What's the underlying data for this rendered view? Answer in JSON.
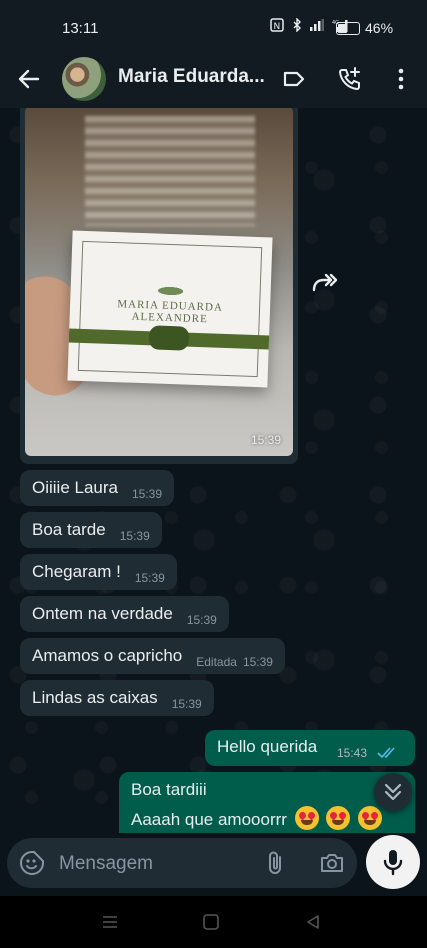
{
  "status_bar": {
    "time": "13:11",
    "battery": "46%",
    "battery_level": 0.46,
    "network": "4G"
  },
  "header": {
    "contact_name": "Maria Eduarda...",
    "icons": [
      "back-arrow-icon",
      "label-tag-icon",
      "add-call-icon",
      "more-vert-icon"
    ]
  },
  "chat": {
    "image_message": {
      "box_text": [
        "MARIA EDUARDA",
        "ALEXANDRE"
      ],
      "time": "15:39"
    },
    "incoming": [
      {
        "text": "Oiiiie Laura",
        "time": "15:39"
      },
      {
        "text": "Boa tarde",
        "time": "15:39"
      },
      {
        "text": "Chegaram !",
        "time": "15:39"
      },
      {
        "text": "Ontem na verdade",
        "time": "15:39"
      },
      {
        "text": "Amamos o capricho",
        "edited": "Editada",
        "time": "15:39"
      },
      {
        "text": "Lindas as caixas",
        "time": "15:39"
      }
    ],
    "outgoing": [
      {
        "text": "Hello querida",
        "time": "15:43",
        "status": "read"
      },
      {
        "line1": "Boa tardiii",
        "line2": "Aaaah que amooorrr"
      }
    ]
  },
  "composer": {
    "placeholder": "Mensagem"
  },
  "colors": {
    "bg": "#0b141a",
    "incoming_bubble": "#202c33",
    "outgoing_bubble": "#005c4b",
    "read_ticks": "#53bdeb",
    "accent": "#00a884"
  }
}
